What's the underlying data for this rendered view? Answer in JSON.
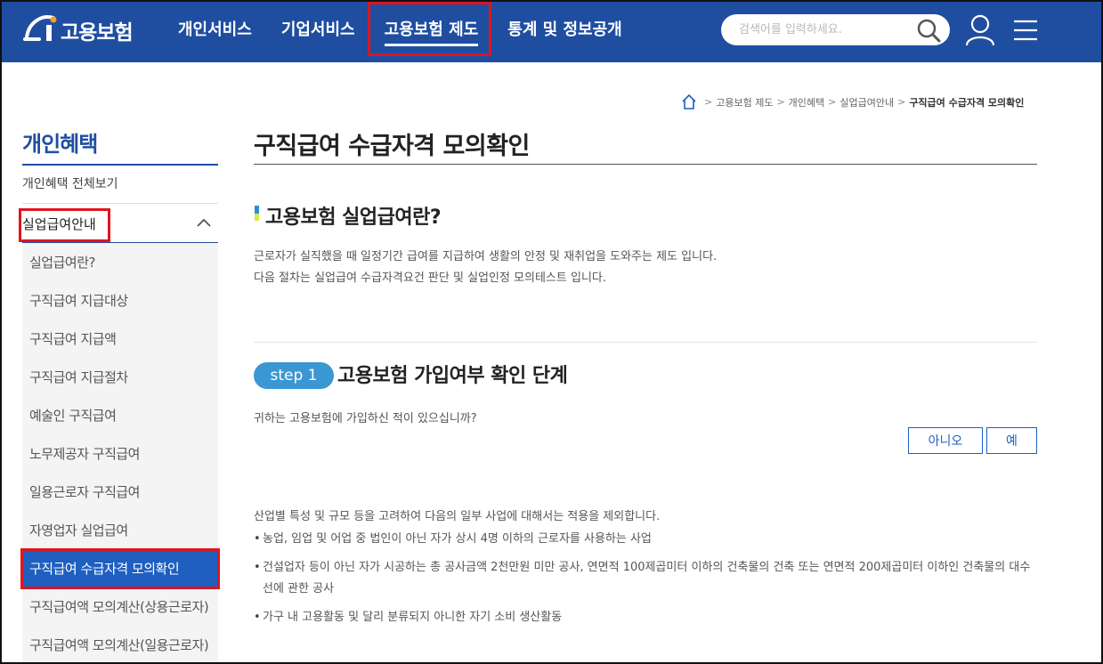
{
  "header": {
    "logo_text": "고용보험",
    "nav": [
      "개인서비스",
      "기업서비스",
      "고용보험 제도",
      "통계 및 정보공개"
    ],
    "search_placeholder": "검색어를 입력하세요."
  },
  "breadcrumb": {
    "items": [
      "고용보험 제도",
      "개인혜택",
      "실업급여안내"
    ],
    "current": "구직급여 수급자격 모의확인"
  },
  "sidebar": {
    "title": "개인혜택",
    "all_label": "개인혜택 전체보기",
    "category": "실업급여안내",
    "items": [
      "실업급여란?",
      "구직급여 지급대상",
      "구직급여 지급액",
      "구직급여 지급절차",
      "예술인 구직급여",
      "노무제공자 구직급여",
      "일용근로자 구직급여",
      "자영업자 실업급여",
      "구직급여 수급자격 모의확인",
      "구직급여액 모의계산(상용근로자)",
      "구직급여액 모의계산(일용근로자)"
    ],
    "active_index": 8
  },
  "main": {
    "title": "구직급여 수급자격 모의확인",
    "section_title": "고용보험 실업급여란?",
    "desc": [
      "근로자가 실직했을 때 일정기간 급여를 지급하여 생활의 안정 및 재취업을 도와주는 제도 입니다.",
      "다음 절차는 실업급여 수급자격요건 판단 및 실업인정 모의테스트 입니다."
    ],
    "step_label": "step 1",
    "step_title": "고용보험 가입여부 확인 단계",
    "question": "귀하는 고용보험에 가입하신 적이 있으십니까?",
    "btn_no": "아니오",
    "btn_yes": "예",
    "notes_intro": "산업별 특성 및 규모 등을 고려하여 다음의 일부 사업에 대해서는 적용을 제외합니다.",
    "notes": [
      "농업, 임업 및 어업 중 법인이 아닌 자가 상시 4명 이하의 근로자를 사용하는 사업",
      "건설업자 등이 아닌 자가 시공하는 총 공사금액 2천만원 미만 공사, 연면적 100제곱미터 이하의 건축물의 건축 또는 연면적 200제곱미터 이하인 건축물의 대수선에 관한 공사",
      "가구 내 고용활동 및 달리 분류되지 아니한 자기 소비 생산활동"
    ]
  },
  "colors": {
    "header_bg": "#1f4ea1",
    "accent_blue": "#1e5fc0",
    "step_badge": "#3b97d3",
    "highlight_red": "#e0141e"
  }
}
